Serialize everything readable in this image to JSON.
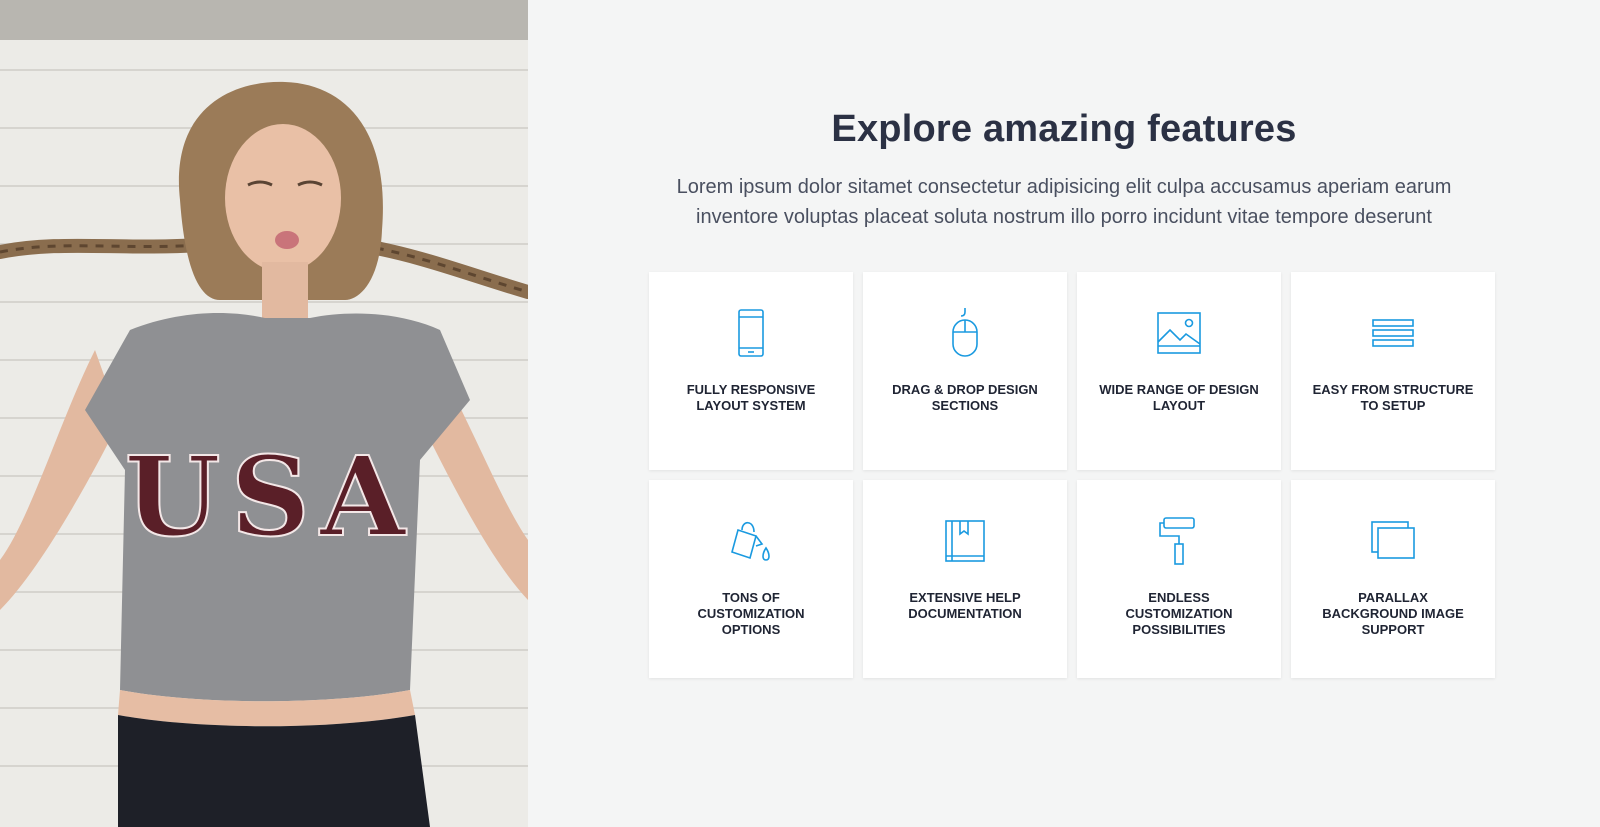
{
  "section": {
    "title": "Explore amazing features",
    "subtitle": "Lorem ipsum dolor sitamet consectetur adipisicing elit culpa accusamus aperiam earum inventore voluptas placeat soluta nostrum illo porro incidunt vitae tempore deserunt"
  },
  "photo": {
    "shirt_text": "USA"
  },
  "colors": {
    "accent": "#1a9ae0",
    "heading": "#2b3144",
    "background": "#f4f5f5"
  },
  "features": [
    {
      "label": "FULLY RESPONSIVE LAYOUT SYSTEM",
      "icon": "smartphone-icon"
    },
    {
      "label": "DRAG & DROP DESIGN SECTIONS",
      "icon": "mouse-icon"
    },
    {
      "label": "WIDE RANGE OF DESIGN LAYOUT",
      "icon": "image-icon"
    },
    {
      "label": "EASY FROM STRUCTURE TO SETUP",
      "icon": "layers-icon"
    },
    {
      "label": "TONS OF CUSTOMIZATION OPTIONS",
      "icon": "paint-bucket-icon"
    },
    {
      "label": "EXTENSIVE HELP DOCUMENTATION",
      "icon": "book-icon"
    },
    {
      "label": "ENDLESS CUSTOMIZATION POSSIBILITIES",
      "icon": "paint-roller-icon"
    },
    {
      "label": "PARALLAX BACKGROUND IMAGE SUPPORT",
      "icon": "windows-icon"
    }
  ]
}
